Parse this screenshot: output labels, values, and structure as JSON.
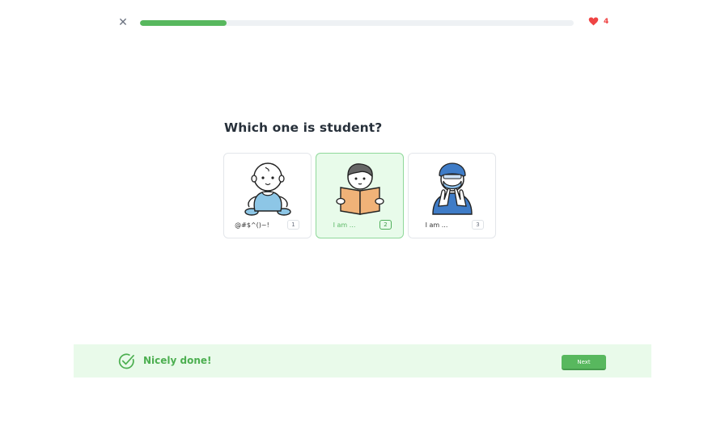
{
  "progress": {
    "value_percent": 20
  },
  "hearts": {
    "count": "4",
    "color": "#ef4444"
  },
  "close": {
    "icon": "close-icon",
    "glyph": "✕"
  },
  "question": {
    "text": "Which one is student?"
  },
  "options": [
    {
      "label": "@#$^()~!",
      "key": "1",
      "image": "baby-icon",
      "selected": false
    },
    {
      "label": "I am ...",
      "key": "2",
      "image": "student-reading-icon",
      "selected": true
    },
    {
      "label": "I am ...",
      "key": "3",
      "image": "doctor-icon",
      "selected": false
    }
  ],
  "feedback": {
    "text": "Nicely done!",
    "icon": "check-circle-icon",
    "color": "#4caf50"
  },
  "next_button": {
    "label": "Next"
  },
  "colors": {
    "accent": "#58b85e",
    "selected_bg": "#e8fbea",
    "feedback_bg": "#e9faea"
  }
}
